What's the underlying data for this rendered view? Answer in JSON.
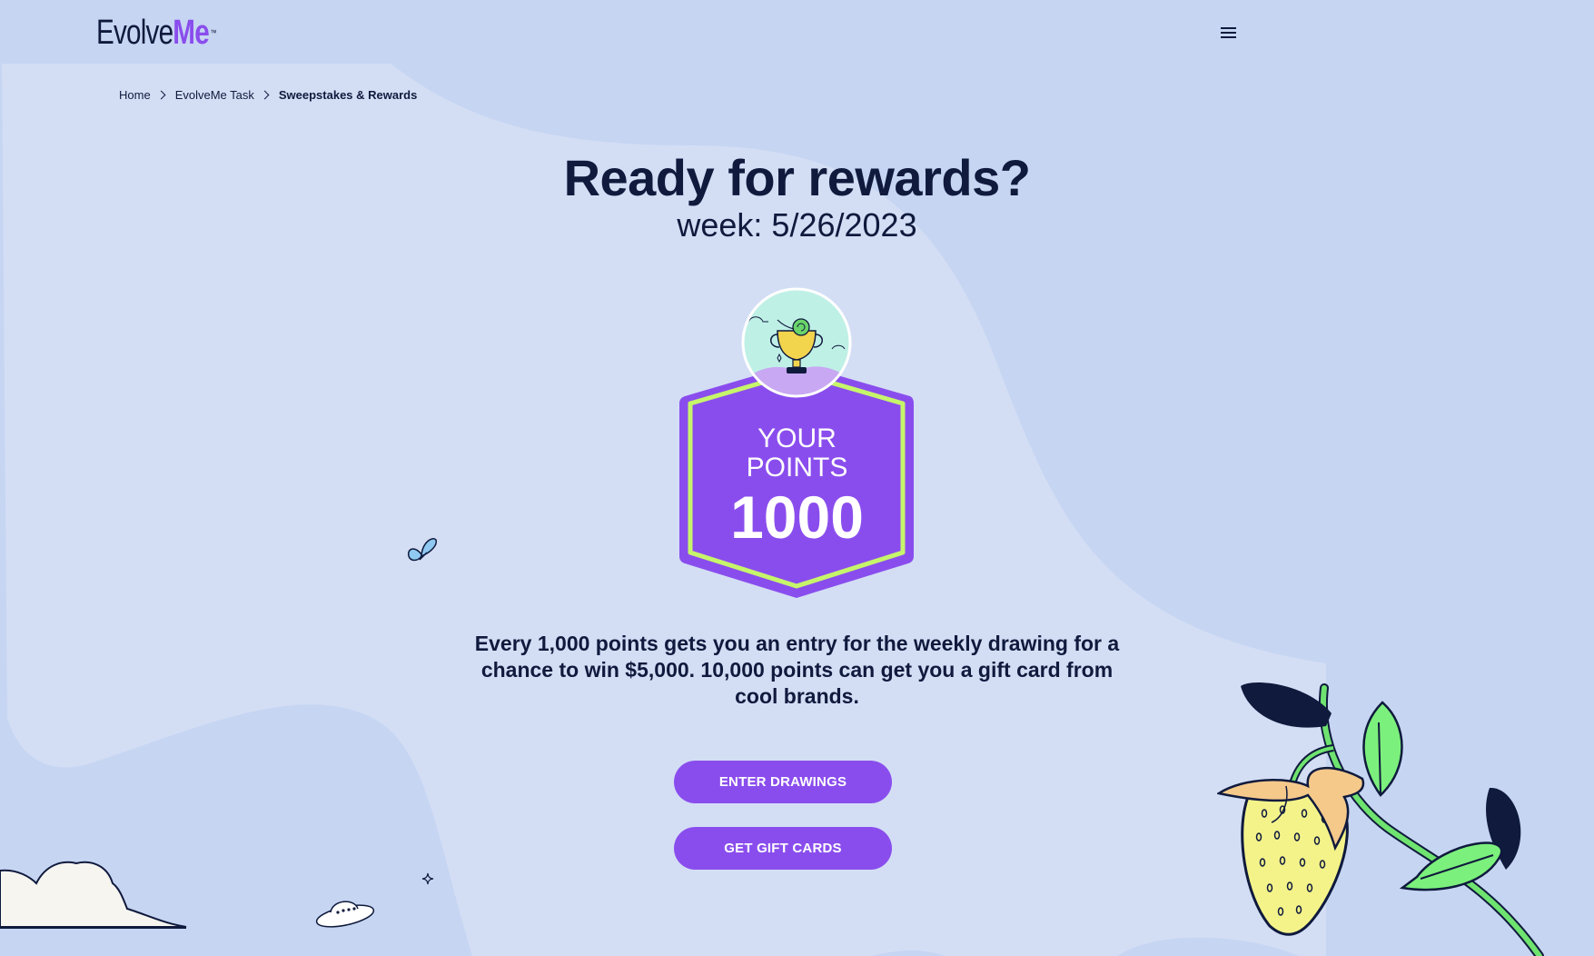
{
  "logo": {
    "part1": "Evolve",
    "part2": "Me",
    "tm": "™"
  },
  "header": {
    "menu_icon": "hamburger-menu-icon"
  },
  "breadcrumb": {
    "items": [
      "Home",
      "EvolveMe Task",
      "Sweepstakes & Rewards"
    ],
    "separator_icon": "chevron-right-icon"
  },
  "main": {
    "title": "Ready for rewards?",
    "subtitle": "week: 5/26/2023",
    "points": {
      "label_line1": "YOUR",
      "label_line2": "POINTS",
      "value": "1000",
      "avatar_icon": "trophy-icon"
    },
    "description": "Every 1,000 points gets you an entry for the weekly drawing for a chance to win $5,000. 10,000 points can get you a gift card from cool brands.",
    "buttons": {
      "enter_drawings": "ENTER DRAWINGS",
      "get_gift_cards": "GET GIFT CARDS"
    }
  },
  "colors": {
    "background": "#c6d5f2",
    "background_light": "#d3def5",
    "accent_purple": "#8a4ded",
    "accent_green": "#c6f56b",
    "text_dark": "#0f1a3d"
  },
  "decorations": [
    "butterfly-icon",
    "cloud-icon",
    "ufo-icon",
    "sparkle-icon",
    "strawberry-plant-icon"
  ]
}
